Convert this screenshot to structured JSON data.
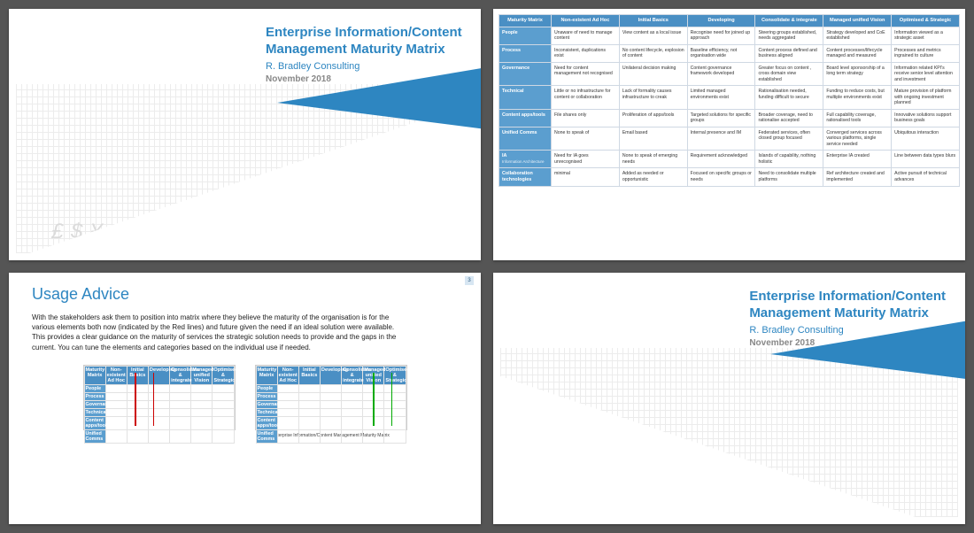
{
  "hero": {
    "title_l1": "Enterprise Information/Content",
    "title_l2": "Management Maturity Matrix",
    "sub": "R. Bradley Consulting",
    "date": "November 2018"
  },
  "matrix": {
    "cols": [
      "Maturity Matrix",
      "Non-existent Ad Hoc",
      "Initial Basics",
      "Developing",
      "Consolidate & integrate",
      "Managed unified Vision",
      "Optimised & Strategic"
    ],
    "rows": [
      {
        "h": "People",
        "sub": "",
        "c": [
          "Unaware of need to manage content",
          "View content as a local issue",
          "Recognise need for joined up approach",
          "Steering groups established, needs aggregated",
          "Strategy developed and CoE established",
          "Information viewed as a strategic asset"
        ]
      },
      {
        "h": "Process",
        "sub": "",
        "c": [
          "Inconsistent, duplications exist",
          "No content lifecycle, explosion of content",
          "Baseline efficiency, not organisation wide",
          "Content process defined and business aligned",
          "Content processes/lifecycle managed and measured",
          "Processes and metrics ingrained to culture"
        ]
      },
      {
        "h": "Governance",
        "sub": "",
        "c": [
          "Need for content management not recognised",
          "Unilateral decision making",
          "Content governance framework developed",
          "Greater focus on content , cross domain view established",
          "Board level sponsorship of a long term strategy",
          "Information related KPI's receive senior level attention and investment"
        ]
      },
      {
        "h": "Technical",
        "sub": "",
        "c": [
          "Little or no infrastructure for content or collaboration",
          "Lack of formality causes infrastructure to creak",
          "Limited managed environments exist",
          "Rationalisation needed, funding difficult to secure",
          "Funding to reduce costs,  but multiple environments exist",
          "Mature provision of platform with ongoing investment planned"
        ]
      },
      {
        "h": "Content apps/tools",
        "sub": "",
        "c": [
          "File shares only",
          "Proliferation of apps/tools",
          "Targeted solutions for specific groups",
          "Broader coverage, need to rationalise accepted",
          "Full capability coverage, rationalised tools",
          "Innovative solutions support business goals"
        ]
      },
      {
        "h": "Unified Comms",
        "sub": "",
        "c": [
          "None to speak of",
          "Email based",
          "Internal presence and IM",
          "Federated services, often closed group focused",
          "Converged services across various platforms, single service needed",
          "Ubiquitous interaction"
        ]
      },
      {
        "h": "IA",
        "sub": "Information Architecture",
        "c": [
          "Need for IA goes unrecognised",
          "None to speak of emerging needs",
          "Requirement acknowledged",
          "Islands of capability, nothing holistic",
          "Enterprise IA created",
          "Line between data types blurs"
        ]
      },
      {
        "h": "Collaboration technologies",
        "sub": "",
        "c": [
          "minimal",
          "Added as needed or opportunistic",
          "Focused on specific groups or needs",
          "Need to consolidate multiple platforms",
          "Ref architecture created and implemented",
          "Active pursuit of technical advances"
        ]
      }
    ]
  },
  "advice": {
    "pageNum": "3",
    "title": "Usage Advice",
    "body": "With the stakeholders ask them to position into matrix where they believe the maturity of the organisation is for the various elements both now (indicated by the Red lines) and future given the need if an ideal solution were available.  This provides a clear guidance on the maturity of services the strategic solution needs to provide and the gaps in the current. You can tune the elements and categories based on the individual use if needed.",
    "caption": "Enterprise Information/Content Management Maturity Matrix"
  }
}
